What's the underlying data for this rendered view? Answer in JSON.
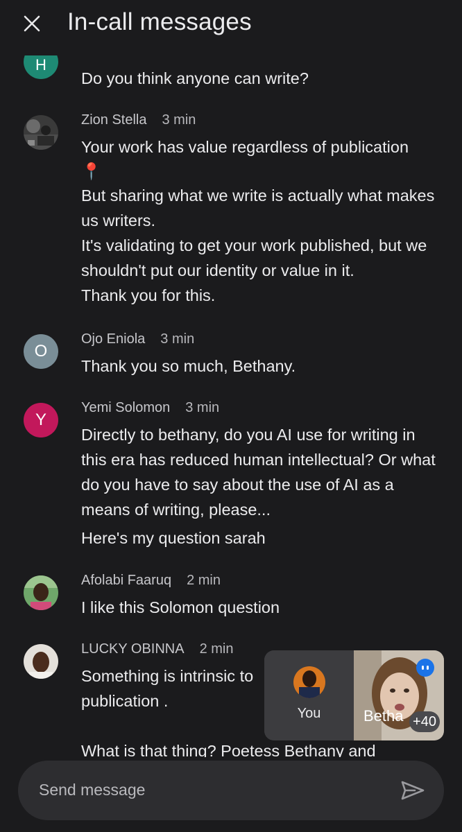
{
  "header": {
    "title": "In-call messages"
  },
  "messages": [
    {
      "sender": "",
      "time": "",
      "lines": [
        "Do you think anyone can write?"
      ]
    },
    {
      "sender": "Zion Stella",
      "time": "3 min",
      "lines": [
        "Your work has value regardless of publication",
        "📍",
        "But sharing what we write is actually what makes us writers.",
        "It's validating to get your work published, but we shouldn't put our identity or value in it.",
        "Thank you for this."
      ]
    },
    {
      "sender": "Ojo Eniola",
      "time": "3 min",
      "avatar_letter": "O",
      "lines": [
        "Thank you so much, Bethany."
      ]
    },
    {
      "sender": "Yemi Solomon",
      "time": "3 min",
      "avatar_letter": "Y",
      "lines": [
        "Directly to bethany, do you AI use for writing in this era has reduced human intellectual? Or what do you have to say about the use of AI as a means of writing, please...",
        "Here's my question sarah"
      ]
    },
    {
      "sender": "Afolabi Faaruq",
      "time": "2 min",
      "lines": [
        "I like this Solomon question"
      ]
    },
    {
      "sender": "LUCKY OBINNA",
      "time": "2 min",
      "lines": [
        "Something is intrinsic to",
        "publication .",
        "",
        "What is that thing? Poetess Bethany and"
      ]
    }
  ],
  "composer": {
    "placeholder": "Send message"
  },
  "pip": {
    "you_label": "You",
    "participant_label": "Betha",
    "extra_count": "+40"
  },
  "colors": {
    "avatar_o": "#7a8e97",
    "avatar_y": "#c2185b",
    "avatar_top": "#1e8a74",
    "speaking_badge": "#1a73e8"
  },
  "icons": {
    "close": "close-icon",
    "send": "send-icon",
    "speaking": "speaking-indicator-icon"
  }
}
